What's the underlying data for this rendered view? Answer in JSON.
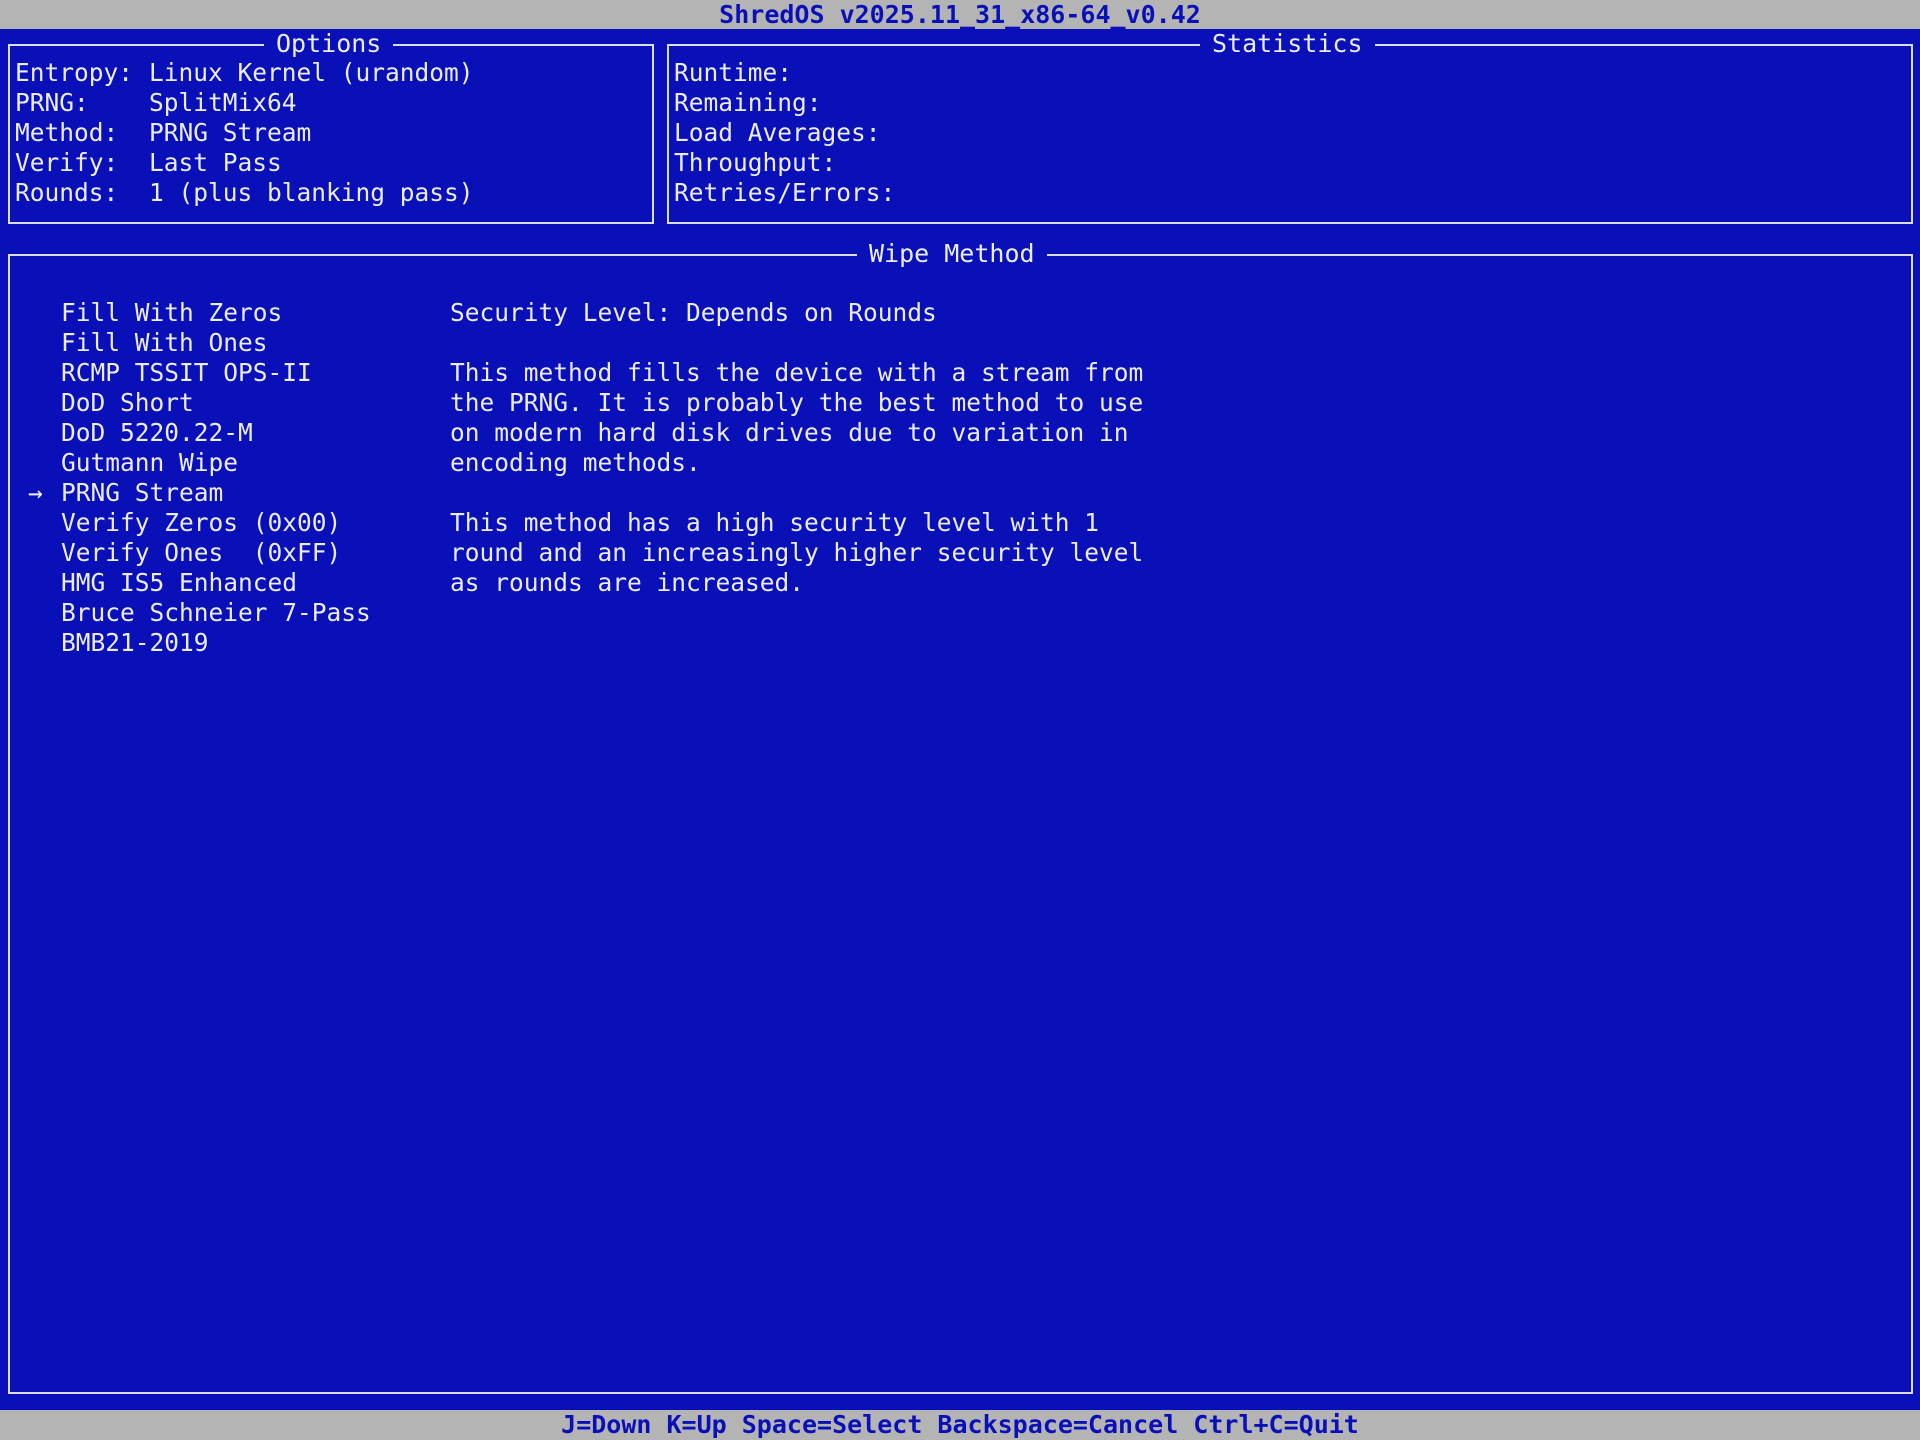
{
  "header": {
    "title": "ShredOS v2025.11_31_x86-64_v0.42"
  },
  "options": {
    "title": "Options",
    "rows": [
      {
        "key": "Entropy:",
        "value": "Linux Kernel (urandom)"
      },
      {
        "key": "PRNG:",
        "value": "SplitMix64"
      },
      {
        "key": "Method:",
        "value": "PRNG Stream"
      },
      {
        "key": "Verify:",
        "value": "Last Pass"
      },
      {
        "key": "Rounds:",
        "value": "1 (plus blanking pass)"
      }
    ]
  },
  "statistics": {
    "title": "Statistics",
    "rows": [
      "Runtime:",
      "Remaining:",
      "Load Averages:",
      "Throughput:",
      "Retries/Errors:"
    ]
  },
  "wipe_method": {
    "title": "Wipe Method",
    "selected_marker": "→",
    "methods": [
      "Fill With Zeros",
      "Fill With Ones",
      "RCMP TSSIT OPS-II",
      "DoD Short",
      "DoD 5220.22-M",
      "Gutmann Wipe",
      "PRNG Stream",
      "Verify Zeros (0x00)",
      "Verify Ones  (0xFF)",
      "HMG IS5 Enhanced",
      "Bruce Schneier 7-Pass",
      "BMB21-2019"
    ],
    "description": [
      "Security Level: Depends on Rounds",
      "",
      "This method fills the device with a stream from",
      "the PRNG. It is probably the best method to use",
      "on modern hard disk drives due to variation in",
      "encoding methods.",
      "",
      "This method has a high security level with 1",
      "round and an increasingly higher security level",
      "as rounds are increased."
    ]
  },
  "footer": {
    "keys": "J=Down K=Up Space=Select Backspace=Cancel Ctrl+C=Quit"
  },
  "colors": {
    "background": "#0a10b8",
    "bar": "#b4b4b4",
    "text": "#ececff",
    "border": "#dcdcf0"
  }
}
